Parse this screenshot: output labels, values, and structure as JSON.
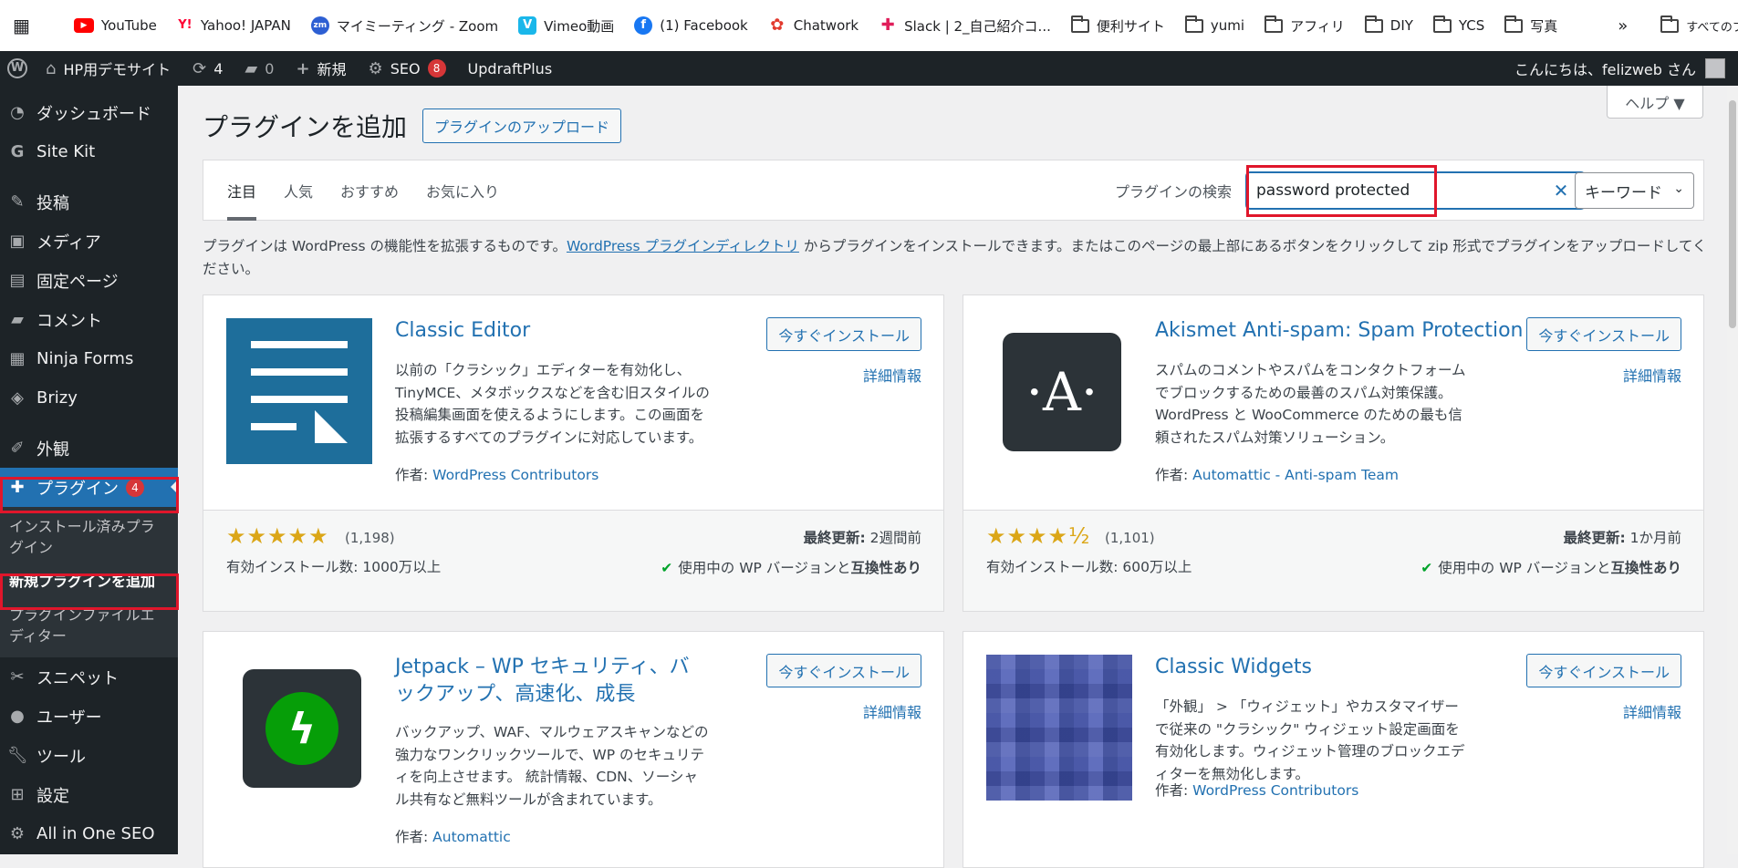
{
  "bookmarks": {
    "items": [
      {
        "label": "YouTube"
      },
      {
        "label": "Yahoo! JAPAN"
      },
      {
        "label": "マイミーティング - Zoom"
      },
      {
        "label": "Vimeo動画"
      },
      {
        "label": "(1) Facebook"
      },
      {
        "label": "Chatwork"
      },
      {
        "label": "Slack | 2_自己紹介コ..."
      }
    ],
    "folders": [
      "便利サイト",
      "yumi",
      "アフィリ",
      "DIY",
      "YCS",
      "写真"
    ],
    "more": "»",
    "all_label": "すべてのブックマーク"
  },
  "adminbar": {
    "site_name": "HP用デモサイト",
    "updates": "4",
    "comments": "0",
    "new_label": "新規",
    "seo_label": "SEO",
    "seo_badge": "8",
    "updraft": "UpdraftPlus",
    "greeting": "こんにちは、felizweb さん"
  },
  "sidebar": {
    "items": [
      {
        "label": "ダッシュボード"
      },
      {
        "label": "Site Kit"
      },
      {
        "label": "投稿"
      },
      {
        "label": "メディア"
      },
      {
        "label": "固定ページ"
      },
      {
        "label": "コメント"
      },
      {
        "label": "Ninja Forms"
      },
      {
        "label": "Brizy"
      },
      {
        "label": "外観"
      },
      {
        "label": "プラグイン",
        "badge": "4"
      },
      {
        "label": "スニペット"
      },
      {
        "label": "ユーザー"
      },
      {
        "label": "ツール"
      },
      {
        "label": "設定"
      },
      {
        "label": "All in One SEO"
      }
    ],
    "submenu": [
      "インストール済みプラグイン",
      "新規プラグインを追加",
      "プラグインファイルエディター"
    ]
  },
  "page": {
    "title": "プラグインを追加",
    "upload_label": "プラグインのアップロード",
    "help_label": "ヘルプ ▼"
  },
  "filter": {
    "tabs": [
      "注目",
      "人気",
      "おすすめ",
      "お気に入り"
    ],
    "search_label": "プラグインの検索",
    "search_value": "password protected",
    "search_type": "キーワード"
  },
  "intro": {
    "before": "プラグインは WordPress の機能性を拡張するものです。",
    "link": "WordPress プラグインディレクトリ",
    "after": " からプラグインをインストールできます。またはこのページの最上部にあるボタンをクリックして zip 形式でプラグインをアップロードしてください。"
  },
  "plugins": [
    {
      "name": "Classic Editor",
      "desc": "以前の「クラシック」エディターを有効化し、TinyMCE、メタボックスなどを含む旧スタイルの投稿編集画面を使えるようにします。この画面を拡張するすべてのプラグインに対応しています。",
      "author_prefix": "作者: ",
      "author": "WordPress Contributors",
      "install": "今すぐインストール",
      "more": "詳細情報",
      "stars": "★★★★★",
      "rating": 5,
      "ratings": "(1,198)",
      "installs": "有効インストール数: 1000万以上",
      "updated_label": "最終更新:",
      "updated": " 2週間前",
      "compat_pre": "使用中の WP バージョンと",
      "compat_bold": "互換性あり"
    },
    {
      "name": "Akismet Anti-spam: Spam Protection",
      "desc": "スパムのコメントやスパムをコンタクトフォームでブロックするための最善のスパム対策保護。WordPress と WooCommerce のための最も信頼されたスパム対策ソリューション。",
      "author_prefix": "作者: ",
      "author": "Automattic - Anti-spam Team",
      "install": "今すぐインストール",
      "more": "詳細情報",
      "stars": "★★★★½",
      "rating": 4.5,
      "ratings": "(1,101)",
      "installs": "有効インストール数: 600万以上",
      "updated_label": "最終更新:",
      "updated": " 1か月前",
      "compat_pre": "使用中の WP バージョンと",
      "compat_bold": "互換性あり"
    },
    {
      "name": "Jetpack – WP セキュリティ、バックアップ、高速化、成長",
      "desc": "バックアップ、WAF、マルウェアスキャンなどの強力なワンクリックツールで、WP のセキュリティを向上させます。 統計情報、CDN、ソーシャル共有など無料ツールが含まれています。",
      "author_prefix": "作者: ",
      "author": "Automattic",
      "install": "今すぐインストール",
      "more": "詳細情報"
    },
    {
      "name": "Classic Widgets",
      "desc": "「外観」 > 「ウィジェット」やカスタマイザーで従来の \"クラシック\" ウィジェット設定画面を有効化します。ウィジェット管理のブロックエディターを無効化します。",
      "author_prefix": "作者: ",
      "author": "WordPress Contributors",
      "install": "今すぐインストール",
      "more": "詳細情報"
    }
  ],
  "colors": {
    "accent": "#2271b1",
    "admin_bg": "#1d2327",
    "highlight": "#e0162b",
    "star": "#dba617"
  }
}
